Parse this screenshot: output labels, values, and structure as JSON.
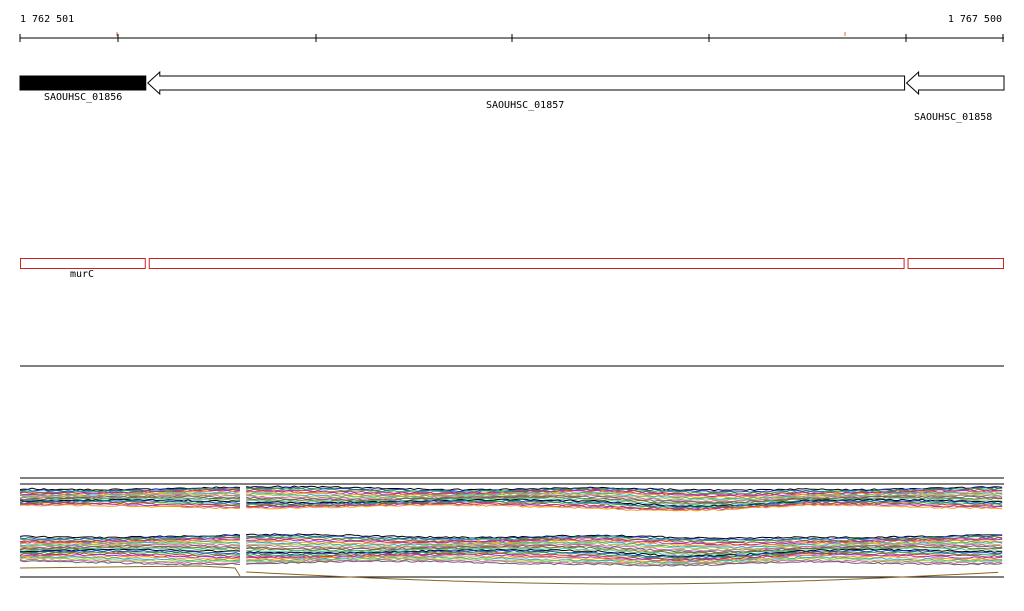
{
  "ruler": {
    "start_label": "1 762 501",
    "end_label": "1 767 500",
    "start": 1762501,
    "end": 1767500
  },
  "genes": [
    {
      "name": "SAOUHSC_01856",
      "start": 1762501,
      "end": 1763140,
      "strand": "-",
      "fill": "#000000"
    },
    {
      "name": "SAOUHSC_01857",
      "start": 1763140,
      "end": 1766995,
      "strand": "-",
      "fill": "#ffffff"
    },
    {
      "name": "SAOUHSC_01858",
      "start": 1766995,
      "end": 1767500,
      "strand": "-",
      "fill": "#ffffff"
    }
  ],
  "features": [
    {
      "name": "murC",
      "start": 1762501,
      "end": 1763140
    },
    {
      "name": "",
      "start": 1763155,
      "end": 1766995
    },
    {
      "name": "",
      "start": 1767010,
      "end": 1767500
    }
  ],
  "colors": {
    "axis": "#000000",
    "tick_marker": "#e06040",
    "feature_border": "#cc2222",
    "coverage_palette": [
      "#000000",
      "#2244cc",
      "#22aa44",
      "#cc3333",
      "#9933cc",
      "#ff9900",
      "#33aacc",
      "#99cc33",
      "#cc66aa",
      "#666666",
      "#886622",
      "#44cc99"
    ]
  },
  "coverage": {
    "gap_start": 1763620,
    "gap_end": 1763650
  }
}
